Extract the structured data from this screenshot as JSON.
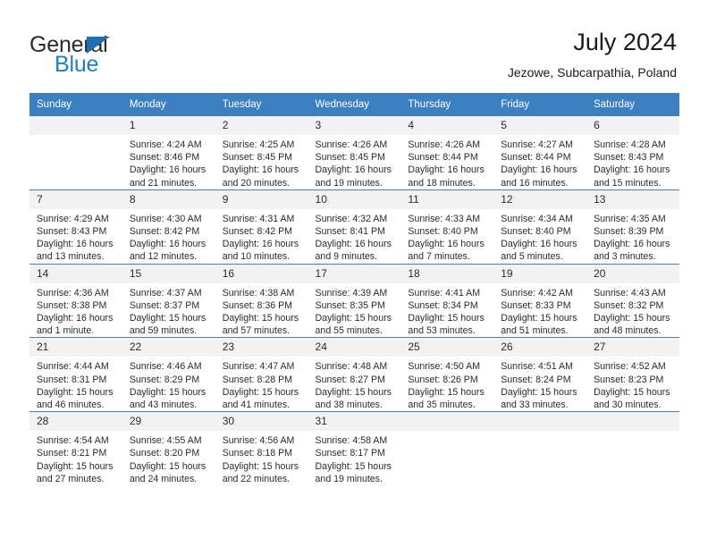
{
  "logo": {
    "word_one": "General",
    "word_two": "Blue",
    "triangle_icon": "triangle-icon"
  },
  "header": {
    "title": "July 2024",
    "subtitle": "Jezowe, Subcarpathia, Poland"
  },
  "calendar": {
    "weekday_headers": [
      "Sunday",
      "Monday",
      "Tuesday",
      "Wednesday",
      "Thursday",
      "Friday",
      "Saturday"
    ],
    "colors": {
      "header_blue": "#3c7fc1",
      "daynum_band": "#f2f2f2",
      "row_border": "#4b7fb5",
      "logo_blue": "#1f7fc4"
    },
    "weeks": [
      [
        {
          "day": "",
          "blank": true
        },
        {
          "day": "1",
          "sunrise": "Sunrise: 4:24 AM",
          "sunset": "Sunset: 8:46 PM",
          "daylight_1": "Daylight: 16 hours",
          "daylight_2": "and 21 minutes."
        },
        {
          "day": "2",
          "sunrise": "Sunrise: 4:25 AM",
          "sunset": "Sunset: 8:45 PM",
          "daylight_1": "Daylight: 16 hours",
          "daylight_2": "and 20 minutes."
        },
        {
          "day": "3",
          "sunrise": "Sunrise: 4:26 AM",
          "sunset": "Sunset: 8:45 PM",
          "daylight_1": "Daylight: 16 hours",
          "daylight_2": "and 19 minutes."
        },
        {
          "day": "4",
          "sunrise": "Sunrise: 4:26 AM",
          "sunset": "Sunset: 8:44 PM",
          "daylight_1": "Daylight: 16 hours",
          "daylight_2": "and 18 minutes."
        },
        {
          "day": "5",
          "sunrise": "Sunrise: 4:27 AM",
          "sunset": "Sunset: 8:44 PM",
          "daylight_1": "Daylight: 16 hours",
          "daylight_2": "and 16 minutes."
        },
        {
          "day": "6",
          "sunrise": "Sunrise: 4:28 AM",
          "sunset": "Sunset: 8:43 PM",
          "daylight_1": "Daylight: 16 hours",
          "daylight_2": "and 15 minutes."
        }
      ],
      [
        {
          "day": "7",
          "sunrise": "Sunrise: 4:29 AM",
          "sunset": "Sunset: 8:43 PM",
          "daylight_1": "Daylight: 16 hours",
          "daylight_2": "and 13 minutes."
        },
        {
          "day": "8",
          "sunrise": "Sunrise: 4:30 AM",
          "sunset": "Sunset: 8:42 PM",
          "daylight_1": "Daylight: 16 hours",
          "daylight_2": "and 12 minutes."
        },
        {
          "day": "9",
          "sunrise": "Sunrise: 4:31 AM",
          "sunset": "Sunset: 8:42 PM",
          "daylight_1": "Daylight: 16 hours",
          "daylight_2": "and 10 minutes."
        },
        {
          "day": "10",
          "sunrise": "Sunrise: 4:32 AM",
          "sunset": "Sunset: 8:41 PM",
          "daylight_1": "Daylight: 16 hours",
          "daylight_2": "and 9 minutes."
        },
        {
          "day": "11",
          "sunrise": "Sunrise: 4:33 AM",
          "sunset": "Sunset: 8:40 PM",
          "daylight_1": "Daylight: 16 hours",
          "daylight_2": "and 7 minutes."
        },
        {
          "day": "12",
          "sunrise": "Sunrise: 4:34 AM",
          "sunset": "Sunset: 8:40 PM",
          "daylight_1": "Daylight: 16 hours",
          "daylight_2": "and 5 minutes."
        },
        {
          "day": "13",
          "sunrise": "Sunrise: 4:35 AM",
          "sunset": "Sunset: 8:39 PM",
          "daylight_1": "Daylight: 16 hours",
          "daylight_2": "and 3 minutes."
        }
      ],
      [
        {
          "day": "14",
          "sunrise": "Sunrise: 4:36 AM",
          "sunset": "Sunset: 8:38 PM",
          "daylight_1": "Daylight: 16 hours",
          "daylight_2": "and 1 minute."
        },
        {
          "day": "15",
          "sunrise": "Sunrise: 4:37 AM",
          "sunset": "Sunset: 8:37 PM",
          "daylight_1": "Daylight: 15 hours",
          "daylight_2": "and 59 minutes."
        },
        {
          "day": "16",
          "sunrise": "Sunrise: 4:38 AM",
          "sunset": "Sunset: 8:36 PM",
          "daylight_1": "Daylight: 15 hours",
          "daylight_2": "and 57 minutes."
        },
        {
          "day": "17",
          "sunrise": "Sunrise: 4:39 AM",
          "sunset": "Sunset: 8:35 PM",
          "daylight_1": "Daylight: 15 hours",
          "daylight_2": "and 55 minutes."
        },
        {
          "day": "18",
          "sunrise": "Sunrise: 4:41 AM",
          "sunset": "Sunset: 8:34 PM",
          "daylight_1": "Daylight: 15 hours",
          "daylight_2": "and 53 minutes."
        },
        {
          "day": "19",
          "sunrise": "Sunrise: 4:42 AM",
          "sunset": "Sunset: 8:33 PM",
          "daylight_1": "Daylight: 15 hours",
          "daylight_2": "and 51 minutes."
        },
        {
          "day": "20",
          "sunrise": "Sunrise: 4:43 AM",
          "sunset": "Sunset: 8:32 PM",
          "daylight_1": "Daylight: 15 hours",
          "daylight_2": "and 48 minutes."
        }
      ],
      [
        {
          "day": "21",
          "sunrise": "Sunrise: 4:44 AM",
          "sunset": "Sunset: 8:31 PM",
          "daylight_1": "Daylight: 15 hours",
          "daylight_2": "and 46 minutes."
        },
        {
          "day": "22",
          "sunrise": "Sunrise: 4:46 AM",
          "sunset": "Sunset: 8:29 PM",
          "daylight_1": "Daylight: 15 hours",
          "daylight_2": "and 43 minutes."
        },
        {
          "day": "23",
          "sunrise": "Sunrise: 4:47 AM",
          "sunset": "Sunset: 8:28 PM",
          "daylight_1": "Daylight: 15 hours",
          "daylight_2": "and 41 minutes."
        },
        {
          "day": "24",
          "sunrise": "Sunrise: 4:48 AM",
          "sunset": "Sunset: 8:27 PM",
          "daylight_1": "Daylight: 15 hours",
          "daylight_2": "and 38 minutes."
        },
        {
          "day": "25",
          "sunrise": "Sunrise: 4:50 AM",
          "sunset": "Sunset: 8:26 PM",
          "daylight_1": "Daylight: 15 hours",
          "daylight_2": "and 35 minutes."
        },
        {
          "day": "26",
          "sunrise": "Sunrise: 4:51 AM",
          "sunset": "Sunset: 8:24 PM",
          "daylight_1": "Daylight: 15 hours",
          "daylight_2": "and 33 minutes."
        },
        {
          "day": "27",
          "sunrise": "Sunrise: 4:52 AM",
          "sunset": "Sunset: 8:23 PM",
          "daylight_1": "Daylight: 15 hours",
          "daylight_2": "and 30 minutes."
        }
      ],
      [
        {
          "day": "28",
          "sunrise": "Sunrise: 4:54 AM",
          "sunset": "Sunset: 8:21 PM",
          "daylight_1": "Daylight: 15 hours",
          "daylight_2": "and 27 minutes."
        },
        {
          "day": "29",
          "sunrise": "Sunrise: 4:55 AM",
          "sunset": "Sunset: 8:20 PM",
          "daylight_1": "Daylight: 15 hours",
          "daylight_2": "and 24 minutes."
        },
        {
          "day": "30",
          "sunrise": "Sunrise: 4:56 AM",
          "sunset": "Sunset: 8:18 PM",
          "daylight_1": "Daylight: 15 hours",
          "daylight_2": "and 22 minutes."
        },
        {
          "day": "31",
          "sunrise": "Sunrise: 4:58 AM",
          "sunset": "Sunset: 8:17 PM",
          "daylight_1": "Daylight: 15 hours",
          "daylight_2": "and 19 minutes."
        },
        {
          "day": "",
          "blank": true
        },
        {
          "day": "",
          "blank": true
        },
        {
          "day": "",
          "blank": true
        }
      ]
    ]
  }
}
